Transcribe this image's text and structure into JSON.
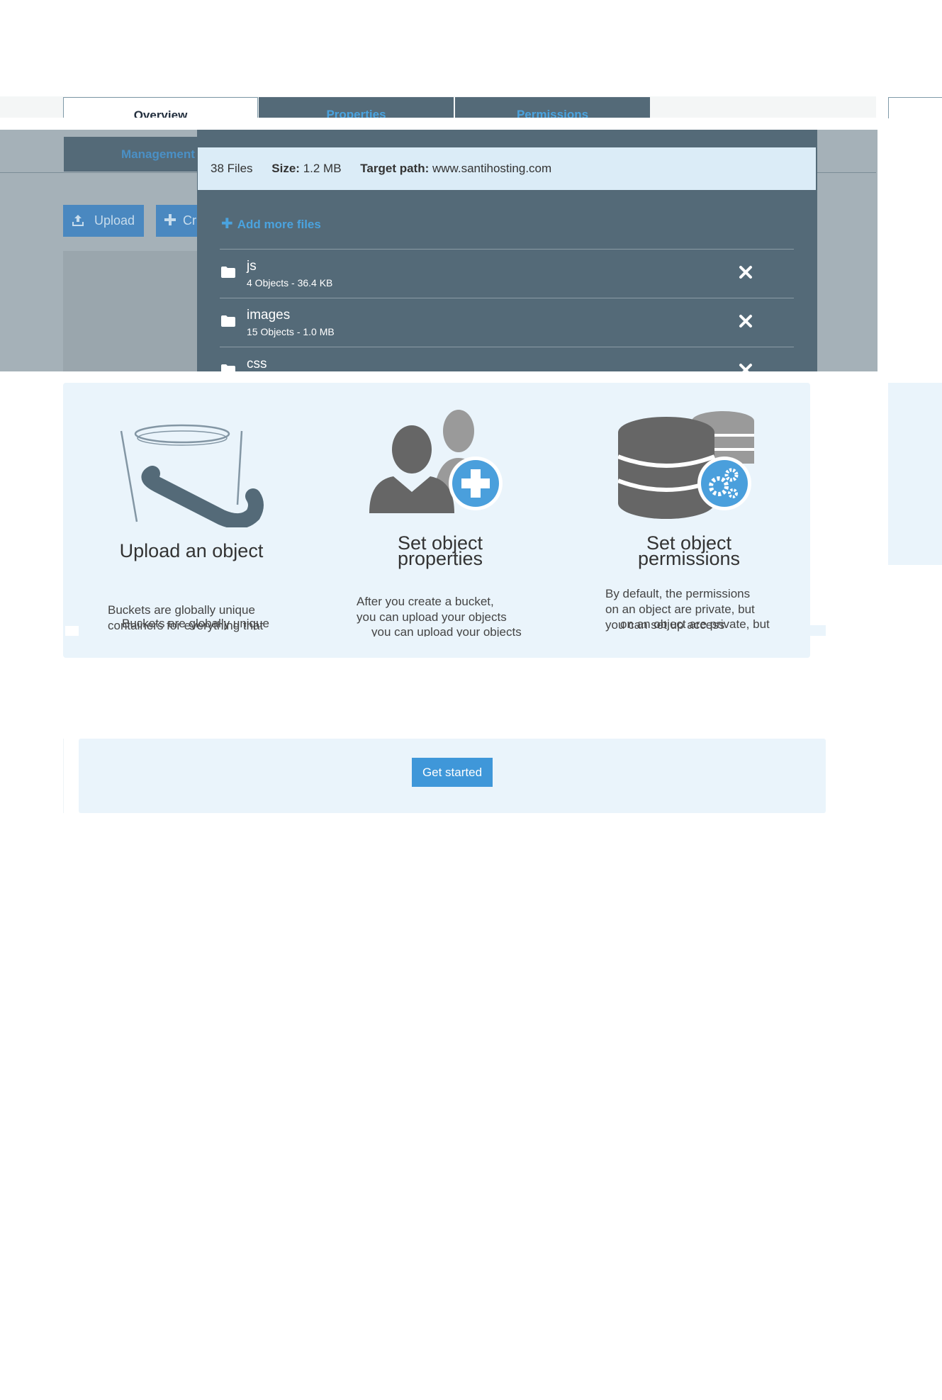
{
  "tabs": {
    "overview": "Overview",
    "properties": "Properties",
    "permissions": "Permissions",
    "management": "Management"
  },
  "toolbar": {
    "upload_label": "Upload",
    "create_label": "Cr"
  },
  "modal": {
    "files_count": "38 Files",
    "size_label": "Size:",
    "size_value": "1.2 MB",
    "target_label": "Target path:",
    "target_value": "www.santihosting.com",
    "add_more": "Add more files",
    "items": [
      {
        "name": "js",
        "meta": "4 Objects - 36.4 KB"
      },
      {
        "name": "images",
        "meta": "15 Objects - 1.0 MB"
      },
      {
        "name": "css",
        "meta": ""
      }
    ]
  },
  "info": {
    "columns": [
      {
        "title": "Upload an object",
        "desc": "Buckets are globally unique\ncontainers for everything that",
        "ghost": "Buckets are globally unique"
      },
      {
        "title": "Set object\nproperties",
        "desc": "After you create a bucket,\nyou can upload your objects",
        "ghost": "you can upload your objects"
      },
      {
        "title": "Set object\npermissions",
        "desc": "By default, the permissions\non an object are private, but\nyou can set up access",
        "ghost": "on an object are private, but"
      }
    ]
  },
  "get_started": {
    "button_label": "Get started"
  },
  "colors": {
    "tab_dark": "#546a78",
    "accent": "#4aa3df",
    "panel_bg": "#eaf4fb",
    "button": "#3f97d9",
    "icon_gray": "#666666",
    "icon_blue": "#4a9fdc"
  }
}
